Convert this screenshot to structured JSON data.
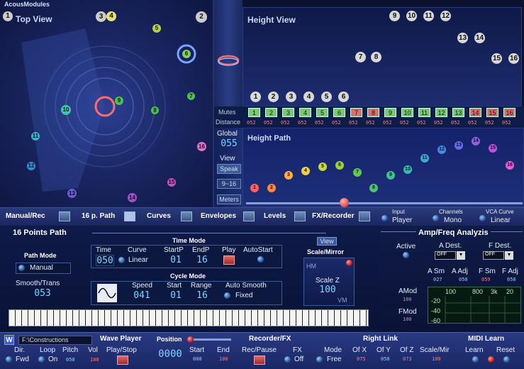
{
  "app_title": "AcousModules",
  "top_view": {
    "title": "Top View",
    "points": [
      "1",
      "2",
      "3",
      "4",
      "5",
      "6",
      "7",
      "8",
      "9",
      "10",
      "11",
      "12",
      "13",
      "14",
      "15",
      "16"
    ]
  },
  "height_view": {
    "title": "Height View"
  },
  "mutes_label": "Mutes",
  "distance_label": "Distance",
  "distance_value": "052",
  "global_label": "Global",
  "global_value": "055",
  "view_label": "View",
  "speak_label": "Speak",
  "range_label": "9~16",
  "meters_label": "Meters",
  "height_path": {
    "title": "Height Path"
  },
  "toolbar": {
    "manual_rec": "Manual/Rec",
    "path16": "16 p. Path",
    "curves": "Curves",
    "envelopes": "Envelopes",
    "levels": "Levels",
    "fx_recorder": "FX/Recorder",
    "input_label": "Input",
    "input_value": "Player",
    "channels_label": "Channels",
    "channels_value": "Mono",
    "vca_label": "VCA Curve",
    "vca_value": "Linear"
  },
  "points_path": {
    "title": "16 Points Path",
    "path_mode_label": "Path Mode",
    "path_mode_value": "Manual",
    "smooth_label": "Smooth/Trans",
    "smooth_value": "053",
    "time_mode": {
      "title": "Time Mode",
      "time_label": "Time",
      "time_value": "050",
      "curve_label": "Curve",
      "curve_value": "Linear",
      "startp_label": "StartP",
      "startp_value": "01",
      "endp_label": "EndP",
      "endp_value": "16",
      "play_label": "Play",
      "autostart_label": "AutoStart"
    },
    "cycle_mode": {
      "title": "Cycle Mode",
      "speed_label": "Speed",
      "speed_value": "041",
      "start_label": "Start",
      "start_value": "01",
      "range_label": "Range",
      "range_value": "16",
      "autosmooth_label": "Auto Smooth",
      "autosmooth_value": "Fixed"
    },
    "view_btn": "View",
    "scale_mirror_label": "Scale/Mirror",
    "hm_label": "HM",
    "vm_label": "VM",
    "scale_z_label": "Scale Z",
    "scale_z_value": "100"
  },
  "amp": {
    "title": "Amp/Freq Analyzis",
    "active_label": "Active",
    "adest_label": "A Dest.",
    "adest_value": "OFF",
    "fdest_label": "F Dest.",
    "fdest_value": "OFF",
    "asm_label": "A Sm",
    "asm_value": "027",
    "aadj_label": "A Adj",
    "aadj_value": "050",
    "fsm_label": "F Sm",
    "fsm_value": "059",
    "fadj_label": "F Adj",
    "fadj_value": "050",
    "amod_label": "AMod",
    "amod_value": "100",
    "fmod_label": "FMod",
    "fmod_value": "100",
    "freq_ticks": [
      "100",
      "800",
      "3k",
      "20"
    ],
    "db_ticks": [
      "-20",
      "-40",
      "-60"
    ]
  },
  "wave_player": {
    "w_label": "W",
    "path_value": "F:\\Constructions",
    "title": "Wave Player",
    "dir_label": "Dir.",
    "dir_value": "Fwd",
    "loop_label": "Loop",
    "loop_value": "On",
    "pitch_label": "Pitch",
    "pitch_value": "050",
    "vol_label": "Vol",
    "vol_value": "100",
    "playstop_label": "Play/Stop",
    "position_label": "Position",
    "position_value": "0000",
    "start_label": "Start",
    "start_value": "000",
    "end_label": "End",
    "end_value": "100"
  },
  "recorder": {
    "title": "Recorder/FX",
    "recpause_label": "Rec/Pause",
    "fx_label": "FX",
    "fx_value": "Off"
  },
  "right_link": {
    "title": "Right Link",
    "mode_label": "Mode",
    "mode_value": "Free",
    "ofx_label": "Of X",
    "ofx_value": "075",
    "ofy_label": "Of Y",
    "ofy_value": "050",
    "ofz_label": "Of Z",
    "ofz_value": "073",
    "scalemir_label": "Scale/Mir",
    "scalemir_value": "100"
  },
  "midi": {
    "title": "MIDI Learn",
    "learn_label": "Learn",
    "reset_label": "Reset"
  },
  "colors": {
    "accent": "#7fd2ff",
    "value_red": "#ff7d7d",
    "bg": "#0b1230"
  }
}
